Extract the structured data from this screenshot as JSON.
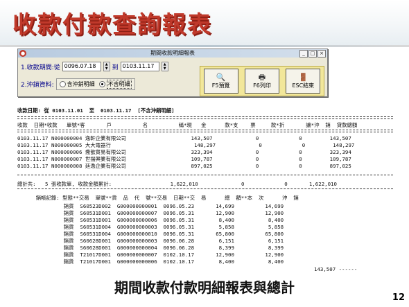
{
  "slide": {
    "title": "收款付款查詢報表",
    "caption": "期間收款付款明細報表與總計",
    "page_number": "12",
    "title_color": "#c0392b"
  },
  "dialog": {
    "window_title": "期間收款明細報表",
    "period_label": "1.收款期間:從",
    "from_date": "0096.07.18",
    "to_label": "到",
    "to_date": "0103.11.17",
    "writeoff_label": "2.沖銷資料:",
    "radio_include": "含沖銷明細",
    "radio_exclude": "不含明細",
    "selected_radio": "不含明細",
    "buttons": {
      "preview": "F5預覽",
      "print": "F6列印",
      "exit": "ESC結束"
    },
    "button_panel_color": "#f2e79a"
  },
  "report": {
    "header_line": "收款日期: 從 0103.11.01  至  0103.11.17  [不含沖銷明細]",
    "columns_line": "收款  日期*收款   單號*客       戶          名          稱*現   金      款*支    票     款*折       讓*沖  銷  貸款總額",
    "rows": [
      "0103.11.17 N000000004 逸軒企業有限公司                     143,507              0             0         143,507",
      "0103.11.17 N000000005 大大電器行                           148,297              0             0         148,297",
      "0103.11.17 N000000006 喬歆貿易有限公司                     323,394              0             0         323,394",
      "0103.11.17 N000000007 世揚興業有限公司                     109,787              0             0         109,787",
      "0103.11.17 N000000008 廷逸企業有限公司                     897,025              0             0         897,025"
    ],
    "total_line": "總計共:   5 張收款單, 收款金額累計:                   1,622,010              0             0       1,622,010",
    "detail_header": "      銷帳記錄: 型態**交易  單號**貨  品  代  號**交易  日期**交  易      總  額**本  次      沖  銷",
    "detail_rows": [
      "               銷貨  S60523D002  G000000000001  0096.05.23       14,699          14,699",
      "               銷貨  S60531D001  G000000000007  0096.05.31       12,900          12,900",
      "               銷貨  S60531D001  G000000000006  0096.05.31        8,400           8,400",
      "               銷貨  S60531D004  G000000000003  0096.05.31        5,858           5,858",
      "               銷貨  S60531D004  G000000000010  0096.05.31       65,800          65,800",
      "               銷貨  S60628D001  G000000000003  0096.06.28        6,151           6,151",
      "               銷貨  S60628D001  G000000000004  0096.06.28        8,399           8,399",
      "               銷貨  T21017D001  G000000000007  0102.10.17       12,900          12,900",
      "               銷貨  T21017D001  G000000000006  0102.10.17        8,400           8,400"
    ],
    "detail_subtotal": "143,507 ------"
  }
}
